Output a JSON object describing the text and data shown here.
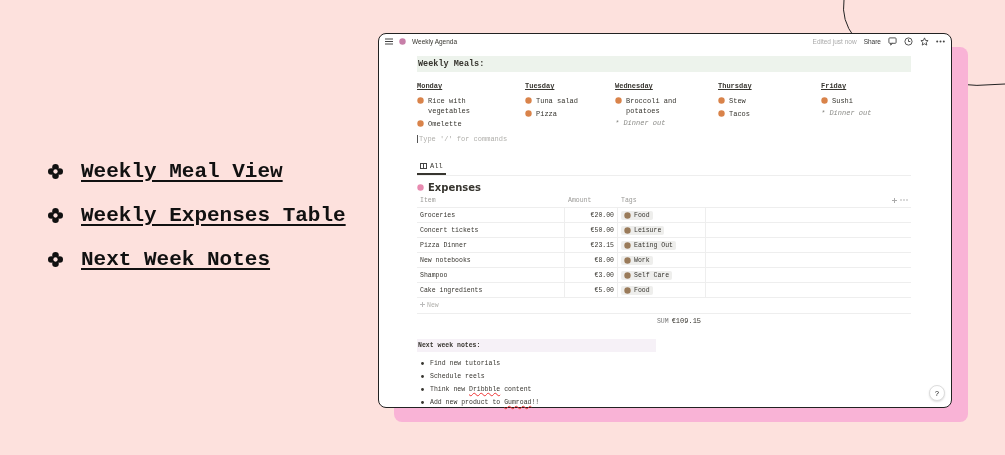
{
  "feature_list": [
    "Weekly Meal View",
    "Weekly Expenses Table",
    "Next Week Notes"
  ],
  "window": {
    "title": "Weekly Agenda",
    "edited": "Edited just now",
    "share": "Share"
  },
  "meals": {
    "heading": "Weekly Meals:",
    "placeholder": "Type '/' for commands",
    "days": [
      {
        "day": "Monday",
        "items": [
          {
            "kind": "dish",
            "text": "Rice with vegetables"
          },
          {
            "kind": "dish",
            "text": "Omelette"
          }
        ]
      },
      {
        "day": "Tuesday",
        "items": [
          {
            "kind": "dish",
            "text": "Tuna salad"
          },
          {
            "kind": "dish",
            "text": "Pizza"
          }
        ]
      },
      {
        "day": "Wednesday",
        "items": [
          {
            "kind": "dish",
            "text": "Broccoli and potatoes"
          },
          {
            "kind": "note",
            "text": "* Dinner out"
          }
        ]
      },
      {
        "day": "Thursday",
        "items": [
          {
            "kind": "dish",
            "text": "Stew"
          },
          {
            "kind": "dish",
            "text": "Tacos"
          }
        ]
      },
      {
        "day": "Friday",
        "items": [
          {
            "kind": "dish",
            "text": "Sushi"
          },
          {
            "kind": "note",
            "text": "* Dinner out"
          }
        ]
      }
    ]
  },
  "view_tabs": [
    {
      "label": "All",
      "selected": true
    }
  ],
  "expenses": {
    "title": "Expenses",
    "columns": [
      "Item",
      "Amount",
      "Tags"
    ],
    "rows": [
      {
        "item": "Groceries",
        "amount": "€20.00",
        "tag": "Food"
      },
      {
        "item": "Concert tickets",
        "amount": "€50.00",
        "tag": "Leisure"
      },
      {
        "item": "Pizza Dinner",
        "amount": "€23.15",
        "tag": "Eating Out"
      },
      {
        "item": "New notebooks",
        "amount": "€8.00",
        "tag": "Work"
      },
      {
        "item": "Shampoo",
        "amount": "€3.00",
        "tag": "Self Care"
      },
      {
        "item": "Cake ingredients",
        "amount": "€5.00",
        "tag": "Food"
      }
    ],
    "new_row": "New",
    "sum_label": "SUM",
    "sum": "€109.15"
  },
  "notes": {
    "heading": "Next week notes:",
    "items": [
      {
        "parts": [
          {
            "text": "Find new tutorials"
          }
        ]
      },
      {
        "parts": [
          {
            "text": "Schedule reels"
          }
        ]
      },
      {
        "parts": [
          {
            "text": "Think new "
          },
          {
            "text": "Dribbble",
            "misspelled": true
          },
          {
            "text": " content"
          }
        ]
      },
      {
        "parts": [
          {
            "text": "Add new product to "
          },
          {
            "text": "Gumroad",
            "misspelled": true
          },
          {
            "text": "!!"
          }
        ]
      }
    ]
  },
  "help": "?"
}
